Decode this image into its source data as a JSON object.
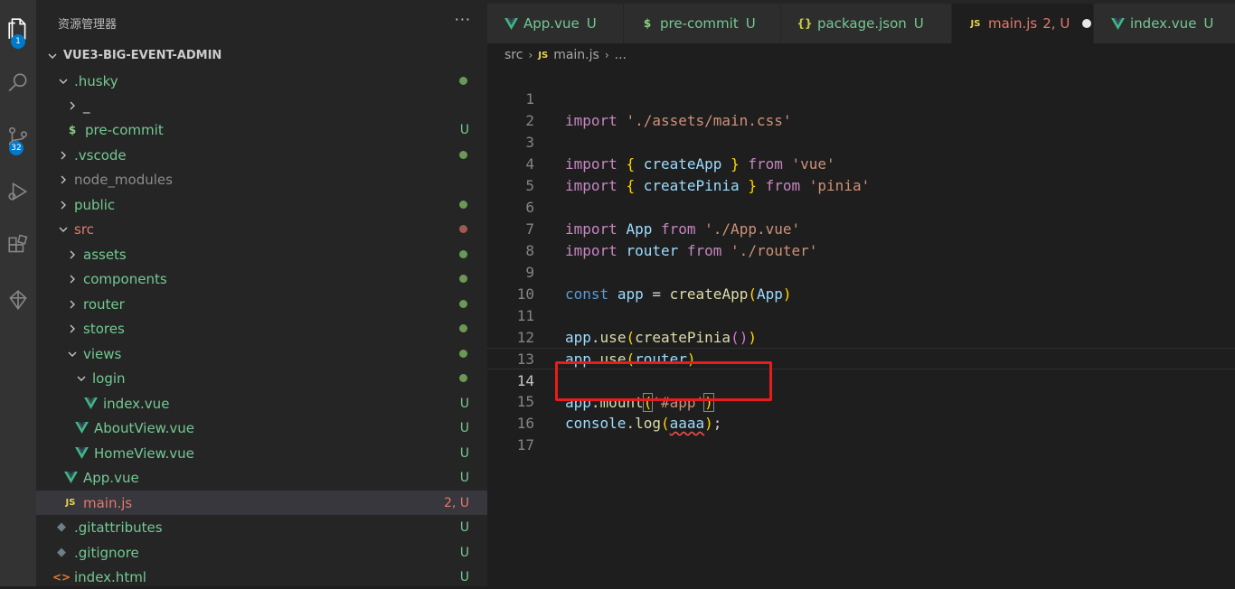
{
  "activity_bar": {
    "items": [
      {
        "name": "explorer-icon",
        "badge": "1"
      },
      {
        "name": "search-icon",
        "badge": ""
      },
      {
        "name": "source-control-icon",
        "badge": "32"
      },
      {
        "name": "run-debug-icon",
        "badge": ""
      },
      {
        "name": "extensions-icon",
        "badge": ""
      },
      {
        "name": "remote-icon",
        "badge": ""
      }
    ]
  },
  "sidebar": {
    "title": "资源管理器",
    "more": "···",
    "project": "VUE3-BIG-EVENT-ADMIN",
    "tree": [
      {
        "label": ".husky",
        "type": "folder-open",
        "color": "green",
        "status": "dot-green"
      },
      {
        "label": "_",
        "type": "folder",
        "color": "white",
        "status": ""
      },
      {
        "label": "pre-commit",
        "type": "file-shell",
        "color": "green",
        "status": "U"
      },
      {
        "label": ".vscode",
        "type": "folder",
        "color": "green",
        "status": "dot-green"
      },
      {
        "label": "node_modules",
        "type": "folder",
        "color": "grey",
        "status": ""
      },
      {
        "label": "public",
        "type": "folder",
        "color": "green",
        "status": "dot-green"
      },
      {
        "label": "src",
        "type": "folder-open",
        "color": "red",
        "status": "dot-red"
      },
      {
        "label": "assets",
        "type": "folder",
        "color": "green",
        "status": "dot-green"
      },
      {
        "label": "components",
        "type": "folder",
        "color": "green",
        "status": "dot-green"
      },
      {
        "label": "router",
        "type": "folder",
        "color": "green",
        "status": "dot-green"
      },
      {
        "label": "stores",
        "type": "folder",
        "color": "green",
        "status": "dot-green"
      },
      {
        "label": "views",
        "type": "folder-open",
        "color": "green",
        "status": "dot-green"
      },
      {
        "label": "login",
        "type": "folder-open",
        "color": "green",
        "status": "dot-green"
      },
      {
        "label": "index.vue",
        "type": "file-vue",
        "color": "green",
        "status": "U"
      },
      {
        "label": "AboutView.vue",
        "type": "file-vue",
        "color": "green",
        "status": "U"
      },
      {
        "label": "HomeView.vue",
        "type": "file-vue",
        "color": "green",
        "status": "U"
      },
      {
        "label": "App.vue",
        "type": "file-vue",
        "color": "green",
        "status": "U"
      },
      {
        "label": "main.js",
        "type": "file-js",
        "color": "red",
        "status": "2, U"
      },
      {
        "label": ".gitattributes",
        "type": "file-git",
        "color": "green",
        "status": "U"
      },
      {
        "label": ".gitignore",
        "type": "file-git",
        "color": "green",
        "status": "U"
      },
      {
        "label": "index.html",
        "type": "file-html",
        "color": "green",
        "status": "U"
      }
    ]
  },
  "tabs": [
    {
      "label": "App.vue",
      "status": "U",
      "icon": "vue-icon"
    },
    {
      "label": "pre-commit",
      "status": "U",
      "icon": "shell-icon"
    },
    {
      "label": "package.json",
      "status": "U",
      "icon": "json-icon"
    },
    {
      "label": "main.js",
      "status": "2, U",
      "icon": "js-icon",
      "active": true
    },
    {
      "label": "index.vue",
      "status": "U",
      "icon": "vue-icon"
    }
  ],
  "breadcrumb": {
    "folder": "src",
    "file": "main.js",
    "rest": "..."
  },
  "editor": {
    "current_line": "14",
    "line_numbers": [
      "1",
      "2",
      "3",
      "4",
      "5",
      "6",
      "7",
      "8",
      "9",
      "10",
      "11",
      "12",
      "13",
      "14",
      "15",
      "16",
      "17"
    ],
    "code": {
      "l1_kw": "import",
      "l1_str": "'./assets/main.css'",
      "l3_kw": "import",
      "l3_ob": "{",
      "l3_id": "createApp",
      "l3_cb": "}",
      "l3_from": "from",
      "l3_str": "'vue'",
      "l4_kw": "import",
      "l4_ob": "{",
      "l4_id": "createPinia",
      "l4_cb": "}",
      "l4_from": "from",
      "l4_str": "'pinia'",
      "l6_kw": "import",
      "l6_id": "App",
      "l6_from": "from",
      "l6_str": "'./App.vue'",
      "l7_kw": "import",
      "l7_id": "router",
      "l7_from": "from",
      "l7_str": "'./router'",
      "l9_kw": "const",
      "l9_id": "app",
      "l9_eq": "=",
      "l9_fn": "createApp",
      "l9_op": "(",
      "l9_arg": "App",
      "l9_cp": ")",
      "l11_obj": "app",
      "l11_dot": ".",
      "l11_fn": "use",
      "l11_op": "(",
      "l11_arg": "createPinia",
      "l11_op2": "(",
      "l11_cp2": ")",
      "l11_cp": ")",
      "l12_obj": "app",
      "l12_dot": ".",
      "l12_fn": "use",
      "l12_op": "(",
      "l12_arg": "router",
      "l12_cp": ")",
      "l14_obj": "app",
      "l14_dot": ".",
      "l14_fn": "mount",
      "l14_op": "(",
      "l14_str": "'#app'",
      "l14_cp": ")",
      "l15_obj": "console",
      "l15_dot": ".",
      "l15_fn": "log",
      "l15_op": "(",
      "l15_arg": "aaaa",
      "l15_cp": ")",
      "l15_semi": ";"
    }
  },
  "colors": {
    "accent": "#007acc",
    "highlight_box": "#e81c1c",
    "git_untracked": "#73c991",
    "git_error": "#e37a6b"
  }
}
